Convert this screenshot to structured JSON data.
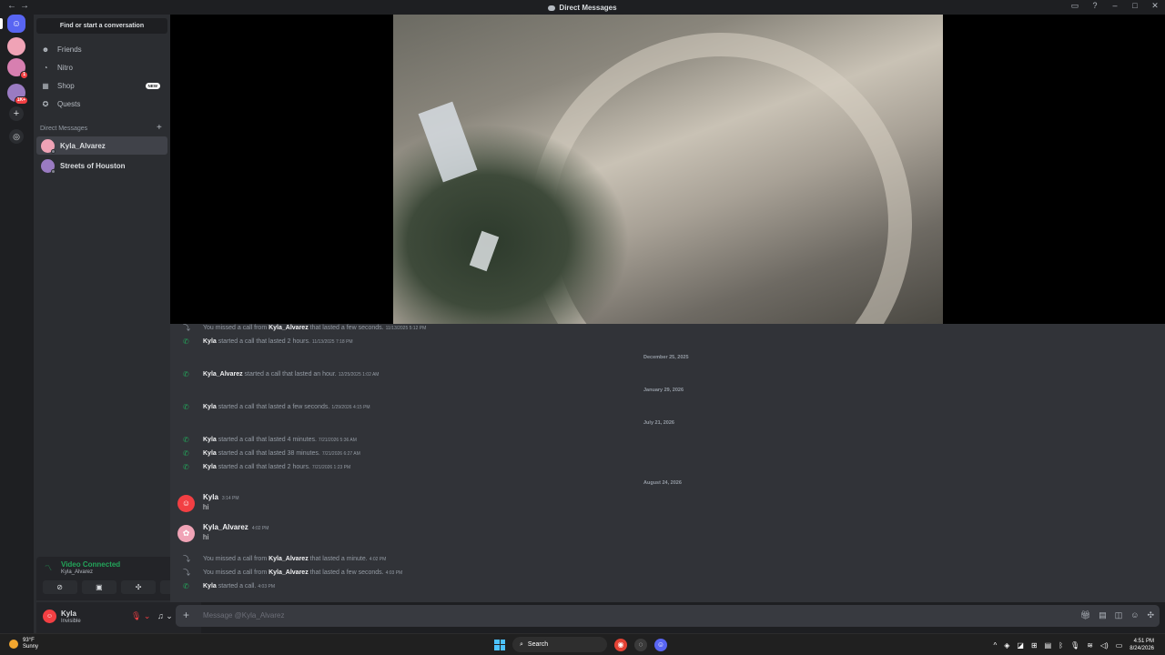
{
  "titlebar": {
    "title": "Direct Messages",
    "back": "←",
    "forward": "→"
  },
  "sidebar": {
    "find_placeholder": "Find or start a conversation",
    "nav": [
      {
        "label": "Friends",
        "icon": "friends-icon"
      },
      {
        "label": "Nitro",
        "icon": "nitro-icon"
      },
      {
        "label": "Shop",
        "icon": "shop-icon",
        "badge": "NEW"
      },
      {
        "label": "Quests",
        "icon": "quests-icon"
      }
    ],
    "dm_header": "Direct Messages",
    "dms": [
      {
        "label": "Kyla_Alvarez",
        "color": "#f0a3b6",
        "selected": true
      },
      {
        "label": "Streets of Houston",
        "color": "#9a7bc2"
      }
    ]
  },
  "servers": {
    "badge_s2": "1",
    "badge_s3": "1K+"
  },
  "voice": {
    "status": "Video Connected",
    "channel": "Kyla_Alvarez"
  },
  "user": {
    "name": "Kyla",
    "status": "Invisible"
  },
  "chat": {
    "rows": [
      {
        "kind": "missed",
        "prefix": "You missed a call from ",
        "who": "Kyla_Alvarez",
        "suffix": " that lasted a few seconds.",
        "ts": "11/13/2025 5:12 PM"
      },
      {
        "kind": "call",
        "who": "Kyla",
        "suffix": " started a call that lasted 2 hours.",
        "ts": "11/13/2025 7:18 PM"
      },
      {
        "kind": "date",
        "label": "December 25, 2025"
      },
      {
        "kind": "call",
        "who": "Kyla_Alvarez",
        "suffix": " started a call that lasted an hour.",
        "ts": "12/25/2025 1:02 AM"
      },
      {
        "kind": "date",
        "label": "January 29, 2026"
      },
      {
        "kind": "call",
        "who": "Kyla",
        "suffix": " started a call that lasted a few seconds.",
        "ts": "1/29/2026 4:15 PM"
      },
      {
        "kind": "date",
        "label": "July 21, 2026"
      },
      {
        "kind": "call",
        "who": "Kyla",
        "suffix": " started a call that lasted 4 minutes.",
        "ts": "7/21/2026 5:36 AM"
      },
      {
        "kind": "call",
        "who": "Kyla",
        "suffix": " started a call that lasted 38 minutes.",
        "ts": "7/21/2026 6:27 AM"
      },
      {
        "kind": "call",
        "who": "Kyla",
        "suffix": " started a call that lasted 2 hours.",
        "ts": "7/21/2026 1:23 PM"
      },
      {
        "kind": "date",
        "label": "August 24, 2026"
      },
      {
        "kind": "msg",
        "who": "Kyla",
        "ts": "3:14 PM",
        "body": "hi",
        "color": "#f23f43"
      },
      {
        "kind": "msg",
        "who": "Kyla_Alvarez",
        "ts": "4:02 PM",
        "body": "hi",
        "color": "#f0a3b6"
      },
      {
        "kind": "missed",
        "prefix": "You missed a call from ",
        "who": "Kyla_Alvarez",
        "suffix": " that lasted a minute.",
        "ts": "4:02 PM"
      },
      {
        "kind": "missed",
        "prefix": "You missed a call from ",
        "who": "Kyla_Alvarez",
        "suffix": " that lasted a few seconds.",
        "ts": "4:03 PM"
      },
      {
        "kind": "call",
        "who": "Kyla",
        "suffix": " started a call.",
        "ts": "4:03 PM"
      }
    ]
  },
  "composer": {
    "placeholder": "Message @Kyla_Alvarez"
  },
  "taskbar": {
    "temp": "93°F",
    "condition": "Sunny",
    "search": "Search",
    "time": "4:51 PM",
    "date": "8/24/2026"
  },
  "colors": {
    "accent": "#5865f2",
    "green": "#23a55a",
    "red": "#f23f43"
  }
}
